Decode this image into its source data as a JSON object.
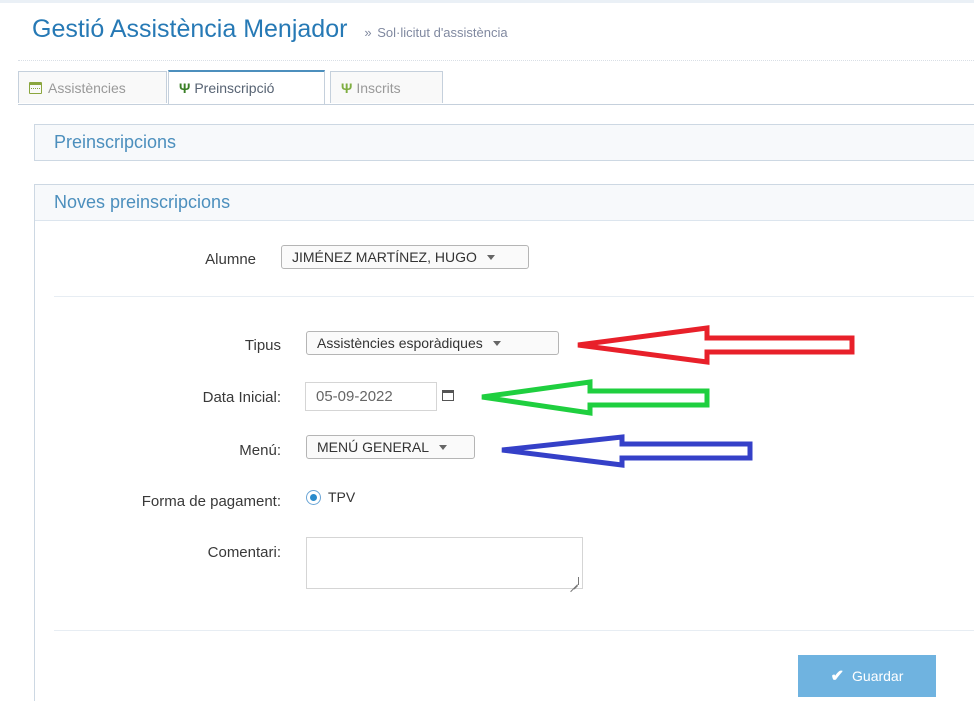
{
  "header": {
    "title": "Gestió Assistència Menjador",
    "raquo": "»",
    "subtitle": "Sol·licitut d'assistència"
  },
  "tabs": [
    {
      "label": "Assistències",
      "icon": "calendar-icon",
      "active": false
    },
    {
      "label": "Preinscripció",
      "icon": "cutlery-icon",
      "active": true
    },
    {
      "label": "Inscrits",
      "icon": "cutlery-icon",
      "active": false
    }
  ],
  "panels": {
    "preinscripcions_title": "Preinscripcions",
    "noves_title": "Noves preinscripcions"
  },
  "form": {
    "alumne_label": "Alumne",
    "alumne_value": "JIMÉNEZ MARTÍNEZ, HUGO",
    "tipus_label": "Tipus",
    "tipus_value": "Assistències esporàdiques",
    "data_label": "Data Inicial:",
    "data_value": "05-09-2022",
    "menu_label": "Menú:",
    "menu_value": "MENÚ GENERAL",
    "pagament_label": "Forma de pagament:",
    "pagament_option": "TPV",
    "comentari_label": "Comentari:",
    "comentari_value": ""
  },
  "actions": {
    "save_label": "Guardar"
  },
  "annotations": {
    "arrow_colors": [
      "#e8202a",
      "#1fcf3f",
      "#3540c8"
    ]
  },
  "colors": {
    "title": "#2679b5",
    "panel_title": "#4c8fbd",
    "save_button": "#6fb3e0"
  }
}
